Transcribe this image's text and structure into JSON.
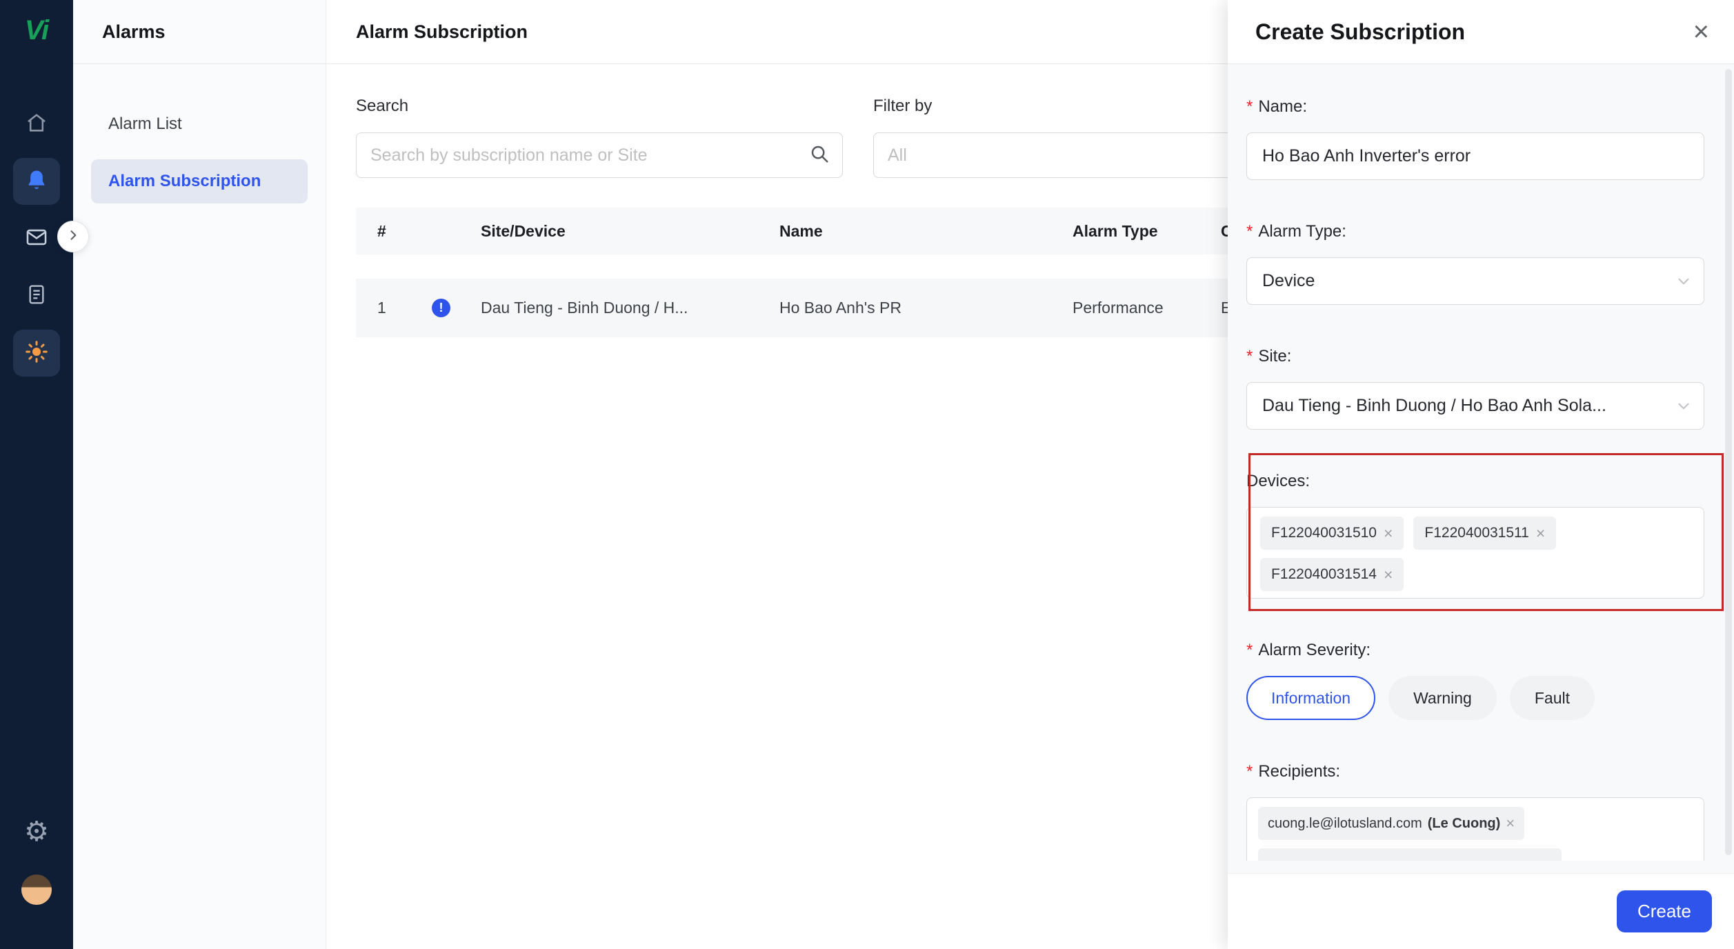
{
  "logo": {
    "text": "Vi",
    "color": "#18a058"
  },
  "icons": {
    "required": "*",
    "close": "×",
    "tag_remove": "×",
    "info": "!",
    "gear": "⚙"
  },
  "colors": {
    "accent": "#2f54eb",
    "annotation_box": "#c62828",
    "required": "#f5222d",
    "sun": "#f59b45",
    "bell": "#3f7bfa"
  },
  "sidebar": {
    "title": "Alarms",
    "items": [
      {
        "label": "Alarm List"
      },
      {
        "label": "Alarm Subscription"
      }
    ]
  },
  "main": {
    "title": "Alarm Subscription",
    "search_label": "Search",
    "search_placeholder": "Search by subscription name or Site",
    "filter_label": "Filter by",
    "filter_value": "All",
    "table": {
      "columns": [
        "#",
        "Site/Device",
        "Name",
        "Alarm Type",
        "C"
      ],
      "rows": [
        {
          "num": "1",
          "site": "Dau Tieng - Binh Duong / H...",
          "name": "Ho Bao Anh's PR",
          "alarm_type": "Performance",
          "extra": "E"
        }
      ]
    }
  },
  "drawer": {
    "title": "Create Subscription",
    "name": {
      "label": "Name:",
      "value": "Ho Bao Anh Inverter's error"
    },
    "alarm_type": {
      "label": "Alarm Type:",
      "value": "Device"
    },
    "site": {
      "label": "Site:",
      "value": "Dau Tieng - Binh Duong / Ho Bao Anh Sola..."
    },
    "devices": {
      "label": "Devices:",
      "tags": [
        "F122040031510",
        "F122040031511",
        "F122040031514"
      ]
    },
    "severity": {
      "label": "Alarm Severity:",
      "options": [
        "Information",
        "Warning",
        "Fault"
      ],
      "selected": "Information"
    },
    "recipients": {
      "label": "Recipients:",
      "tags": [
        {
          "email": "cuong.le@ilotusland.com",
          "name": "(Le Cuong)"
        }
      ]
    },
    "create_label": "Create"
  }
}
